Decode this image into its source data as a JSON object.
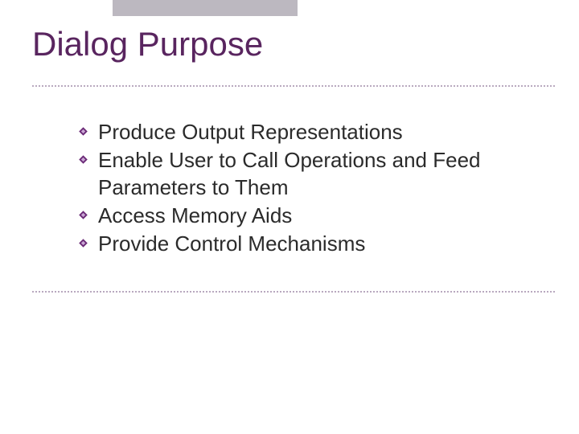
{
  "title": "Dialog Purpose",
  "bullets": [
    "Produce Output Representations",
    "Enable User to Call Operations and Feed Parameters to Them",
    "Access Memory Aids",
    "Provide Control Mechanisms"
  ],
  "colors": {
    "titleColor": "#59255f",
    "ruleColor": "#b9a9bf",
    "bodyText": "#2b2b2b",
    "accentBar": "#bcb8c0",
    "bulletFill": "#6b2a77"
  }
}
